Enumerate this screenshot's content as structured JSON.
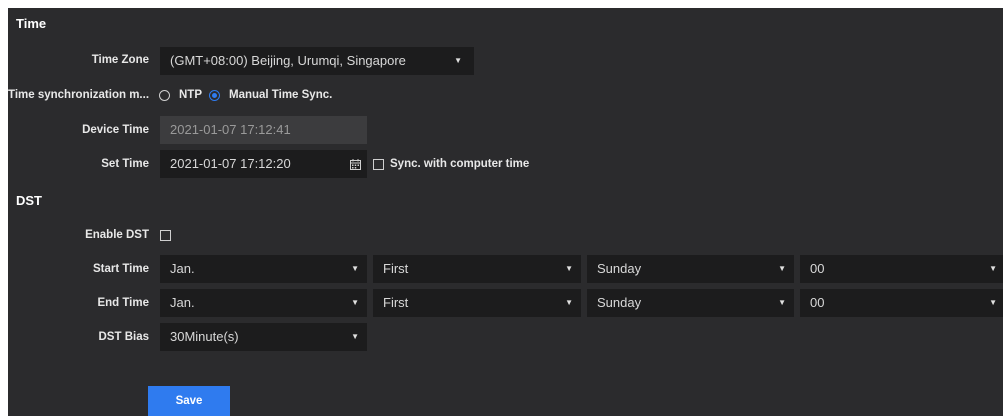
{
  "sections": {
    "time_title": "Time",
    "dst_title": "DST"
  },
  "time": {
    "time_zone_label": "Time Zone",
    "time_zone_value": "(GMT+08:00) Beijing, Urumqi, Singapore",
    "sync_mode_label": "Time synchronization m...",
    "sync_options": [
      {
        "label": "NTP",
        "selected": false
      },
      {
        "label": "Manual Time Sync.",
        "selected": true
      }
    ],
    "device_time_label": "Device Time",
    "device_time_value": "2021-01-07 17:12:41",
    "set_time_label": "Set Time",
    "set_time_value": "2021-01-07 17:12:20",
    "sync_computer_label": "Sync. with computer time",
    "sync_computer_checked": false
  },
  "dst": {
    "enable_label": "Enable DST",
    "enable_checked": false,
    "start_label": "Start Time",
    "start": {
      "month": "Jan.",
      "week": "First",
      "day": "Sunday",
      "hour": "00"
    },
    "end_label": "End Time",
    "end": {
      "month": "Jan.",
      "week": "First",
      "day": "Sunday",
      "hour": "00"
    },
    "bias_label": "DST Bias",
    "bias_value": "30Minute(s)"
  },
  "actions": {
    "save_label": "Save"
  },
  "colors": {
    "panel_bg": "#2b2b2d",
    "input_bg": "#1c1c1d",
    "accent": "#2f7bef"
  },
  "icons": [
    "calendar-icon",
    "caret-down-icon"
  ]
}
